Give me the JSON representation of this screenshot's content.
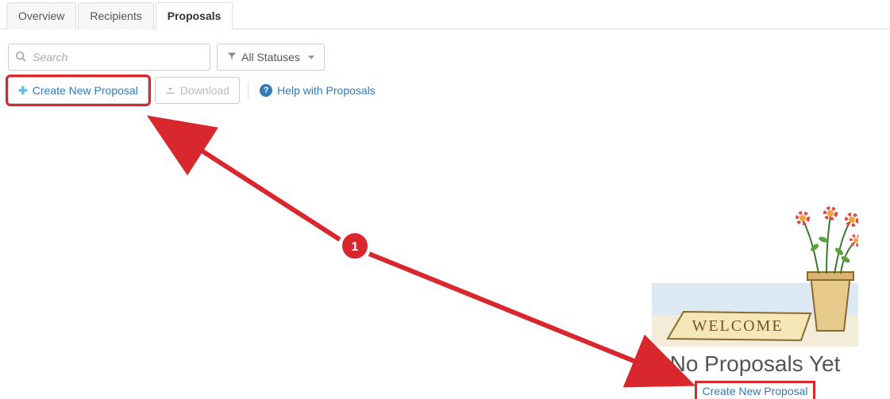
{
  "tabs": {
    "overview": "Overview",
    "recipients": "Recipients",
    "proposals": "Proposals"
  },
  "search": {
    "placeholder": "Search"
  },
  "filter": {
    "all_statuses": "All Statuses"
  },
  "toolbar": {
    "create_label": "Create New Proposal",
    "download_label": "Download",
    "help_label": "Help with Proposals"
  },
  "empty_state": {
    "heading": "No Proposals Yet",
    "link_label": "Create New Proposal",
    "welcome_text": "WELCOME"
  },
  "annotation": {
    "marker": "1"
  }
}
